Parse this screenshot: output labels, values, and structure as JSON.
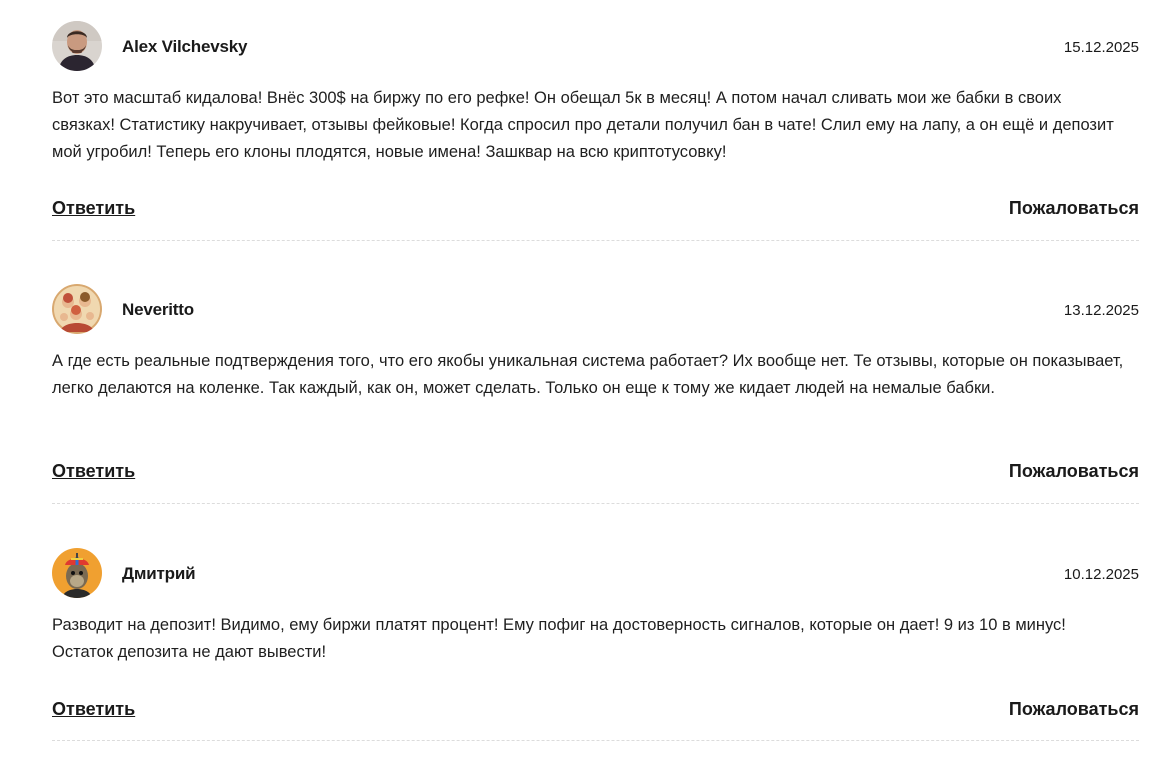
{
  "comments": [
    {
      "author": "Alex Vilchevsky",
      "date": "15.12.2025",
      "text": "Вот это масштаб кидалова! Внёс 300$ на биржу по его рефке! Он обещал 5к в месяц! А потом начал сливать мои же бабки в своих связках! Статистику накручивает, отзывы фейковые! Когда спросил про детали получил бан в чате! Слил ему на лапу, а он ещё и депозит мой угробил! Теперь его клоны плодятся, новые имена! Зашквар на всю криптотусовку!",
      "reply_label": "Ответить",
      "report_label": "Пожаловаться",
      "avatar_icon": "user-photo-avatar"
    },
    {
      "author": "Neveritto",
      "date": "13.12.2025",
      "text": "А где есть реальные подтверждения того, что его якобы уникальная система работает? Их вообще нет. Те отзывы, которые он показывает, легко делаются на коленке. Так каждый, как он, может сделать. Только он еще к тому же кидает людей на немалые бабки.",
      "reply_label": "Ответить",
      "report_label": "Пожаловаться",
      "avatar_icon": "illustrated-group-avatar"
    },
    {
      "author": "Дмитрий",
      "date": "10.12.2025",
      "text": "Разводит на депозит! Видимо, ему биржи платят процент! Ему пофиг на достоверность сигналов, которые он дает! 9 из 10 в минус! Остаток депозита не дают вывести!",
      "reply_label": "Ответить",
      "report_label": "Пожаловаться",
      "avatar_icon": "ape-cartoon-avatar"
    }
  ]
}
